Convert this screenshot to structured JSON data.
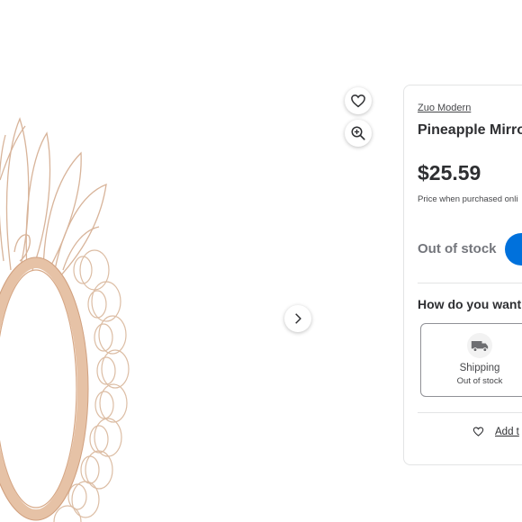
{
  "colors": {
    "accent": "#0071dc",
    "text": "#2e2f32",
    "muted": "#74767c",
    "frame": "#e3b999"
  },
  "product": {
    "brand": "Zuo Modern",
    "title": "Pineapple Mirro",
    "price": "$25.59",
    "price_note": "Price when purchased onli",
    "stock_status": "Out of stock"
  },
  "fulfillment": {
    "heading": "How do you want",
    "shipping_label": "Shipping",
    "shipping_status": "Out of stock"
  },
  "registry": {
    "label": "Add t"
  },
  "icons": [
    "heart-icon",
    "zoom-in-icon",
    "chevron-right-icon",
    "truck-icon"
  ]
}
